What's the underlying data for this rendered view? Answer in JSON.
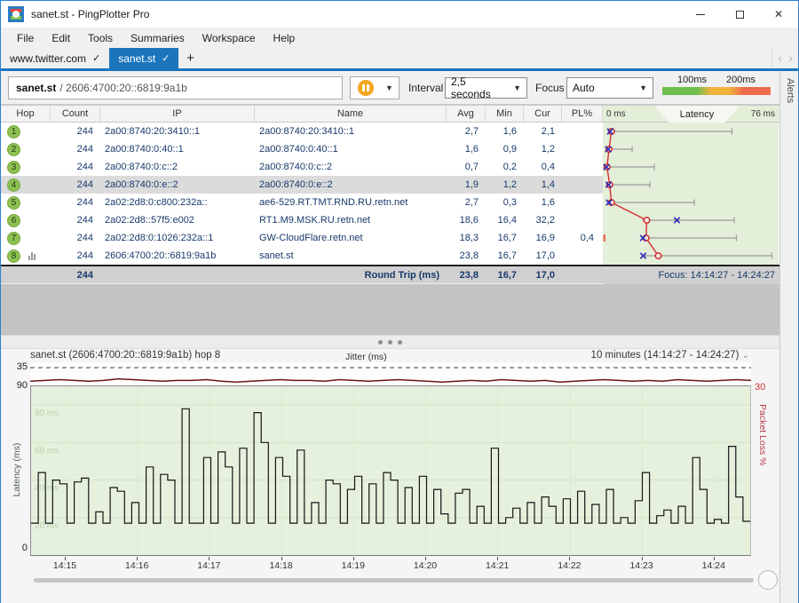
{
  "window": {
    "title": "sanet.st - PingPlotter Pro",
    "icons": {
      "app": "pingplotter-logo",
      "minimize": "minimize",
      "maximize": "maximize",
      "close": "✕"
    }
  },
  "menu": {
    "items": [
      "File",
      "Edit",
      "Tools",
      "Summaries",
      "Workspace",
      "Help"
    ]
  },
  "tabs": {
    "tab1": {
      "label": "www.twitter.com",
      "check": "✓"
    },
    "tab2": {
      "label": "sanet.st",
      "check": "✓"
    },
    "new_tab": "+",
    "scroll_left": "‹",
    "scroll_right": "›"
  },
  "toolbar": {
    "target_host": "sanet.st",
    "target_rest": "/ 2606:4700:20::6819:9a1b",
    "pause_drop": "▼",
    "interval_label": "Interval",
    "interval_value": "2,5 seconds",
    "interval_arrow": "▼",
    "focus_label": "Focus",
    "focus_value": "Auto",
    "focus_arrow": "▼",
    "legend_label_1": "100ms",
    "legend_label_2": "200ms",
    "alerts_label": "Alerts"
  },
  "table": {
    "headers": {
      "hop": "Hop",
      "count": "Count",
      "ip": "IP",
      "name": "Name",
      "avg": "Avg",
      "min": "Min",
      "cur": "Cur",
      "pl": "PL%"
    },
    "latency_header": {
      "left": "0 ms",
      "title": "Latency",
      "right": "76 ms"
    },
    "rows": [
      {
        "hop": "1",
        "count": "244",
        "ip": "2a00:8740:20:3410::1",
        "name": "2a00:8740:20:3410::1",
        "avg": "2,7",
        "min": "1,6",
        "cur": "2,1",
        "pl": "",
        "g": {
          "avg": 2.7,
          "min": 1.6,
          "cur": 2.1,
          "max": 57,
          "pl_tick": false
        }
      },
      {
        "hop": "2",
        "count": "244",
        "ip": "2a00:8740:0:40::1",
        "name": "2a00:8740:0:40::1",
        "avg": "1,6",
        "min": "0,9",
        "cur": "1,2",
        "pl": "",
        "g": {
          "avg": 1.6,
          "min": 0.9,
          "cur": 1.2,
          "max": 12,
          "pl_tick": false
        }
      },
      {
        "hop": "3",
        "count": "244",
        "ip": "2a00:8740:0:c::2",
        "name": "2a00:8740:0:c::2",
        "avg": "0,7",
        "min": "0,2",
        "cur": "0,4",
        "pl": "",
        "g": {
          "avg": 0.7,
          "min": 0.2,
          "cur": 0.4,
          "max": 22,
          "pl_tick": false
        }
      },
      {
        "hop": "4",
        "count": "244",
        "ip": "2a00:8740:0:e::2",
        "name": "2a00:8740:0:e::2",
        "avg": "1,9",
        "min": "1,2",
        "cur": "1,4",
        "pl": "",
        "g": {
          "avg": 1.9,
          "min": 1.2,
          "cur": 1.4,
          "max": 20,
          "pl_tick": false
        }
      },
      {
        "hop": "5",
        "count": "244",
        "ip": "2a02:2d8:0:c800:232a::",
        "name": "ae6-529.RT.TMT.RND.RU.retn.net",
        "avg": "2,7",
        "min": "0,3",
        "cur": "1,6",
        "pl": "",
        "g": {
          "avg": 2.7,
          "min": 0.3,
          "cur": 1.6,
          "max": 40,
          "pl_tick": false
        }
      },
      {
        "hop": "6",
        "count": "244",
        "ip": "2a02:2d8::57f5:e002",
        "name": "RT1.M9.MSK.RU.retn.net",
        "avg": "18,6",
        "min": "16,4",
        "cur": "32,2",
        "pl": "",
        "g": {
          "avg": 18.6,
          "min": 16.4,
          "cur": 32.2,
          "max": 58,
          "pl_tick": false
        }
      },
      {
        "hop": "7",
        "count": "244",
        "ip": "2a02:2d8:0:1026:232a::1",
        "name": "GW-CloudFlare.retn.net",
        "avg": "18,3",
        "min": "16,7",
        "cur": "16,9",
        "pl": "0,4",
        "g": {
          "avg": 18.3,
          "min": 16.7,
          "cur": 16.9,
          "max": 59,
          "pl_tick": true
        }
      },
      {
        "hop": "8",
        "count": "244",
        "ip": "2606:4700:20::6819:9a1b",
        "name": "sanet.st",
        "avg": "23,8",
        "min": "16,7",
        "cur": "17,0",
        "pl": "",
        "g": {
          "avg": 23.8,
          "min": 16.7,
          "cur": 17.0,
          "max": 75,
          "pl_tick": false
        }
      }
    ],
    "summary": {
      "count": "244",
      "label": "Round Trip (ms)",
      "avg": "23,8",
      "min": "16,7",
      "cur": "17,0",
      "focus": "Focus: 14:14:27 - 14:24:27"
    },
    "mini_graph": {
      "ms_max": 76,
      "avg_color": "#d23030",
      "cur_color": "#2a2ab8",
      "whisker_color": "#9a9a9a"
    }
  },
  "timeline": {
    "title": "sanet.st (2606:4700:20::6819:9a1b) hop 8",
    "range_label": "10 minutes (14:14:27 - 14:24:27)",
    "range_chevron": "⌄",
    "jitter_label": "Jitter (ms)",
    "jitter_max_label": "35",
    "lat_top_label": "90",
    "lat_bottom_label": "0",
    "lat_axis_label": "Latency (ms)",
    "pl_top_label": "30",
    "pl_axis_label": "Packet Loss %",
    "grid_labels": [
      "80 ms",
      "60 ms",
      "40 ms",
      "20 ms"
    ],
    "grid_values": [
      80,
      60,
      40,
      20
    ],
    "x_labels": [
      "14:15",
      "14:16",
      "14:17",
      "14:18",
      "14:19",
      "14:20",
      "14:21",
      "14:22",
      "14:23",
      "14:24"
    ],
    "y_max": 90,
    "latency_points": [
      17,
      44,
      17,
      40,
      38,
      17,
      39,
      41,
      17,
      23,
      17,
      36,
      34,
      17,
      28,
      17,
      47,
      17,
      43,
      40,
      17,
      78,
      17,
      17,
      52,
      17,
      55,
      47,
      17,
      57,
      17,
      76,
      60,
      17,
      52,
      42,
      17,
      56,
      17,
      28,
      17,
      40,
      38,
      17,
      35,
      42,
      17,
      38,
      17,
      44,
      40,
      17,
      36,
      17,
      42,
      17,
      35,
      22,
      17,
      33,
      35,
      17,
      26,
      17,
      57,
      17,
      20,
      25,
      17,
      28,
      17,
      31,
      26,
      17,
      30,
      17,
      34,
      17,
      27,
      17,
      35,
      17,
      20,
      17,
      29,
      44,
      17,
      21,
      24,
      17,
      26,
      17,
      52,
      35,
      17,
      19,
      17,
      58,
      31,
      18
    ],
    "jitter_points": [
      3,
      4,
      5,
      4,
      3,
      4,
      6,
      5,
      4,
      3,
      4,
      4,
      5,
      3,
      2,
      3,
      4,
      5,
      4,
      4,
      3,
      5,
      4,
      3,
      4,
      5,
      4,
      3,
      2,
      3,
      4,
      3,
      5,
      4,
      3,
      4,
      2,
      3,
      4,
      5,
      4,
      3,
      4,
      3,
      5,
      4,
      3,
      4,
      5,
      4
    ],
    "trace_color": "#141414",
    "jitter_color": "#6e1414"
  }
}
